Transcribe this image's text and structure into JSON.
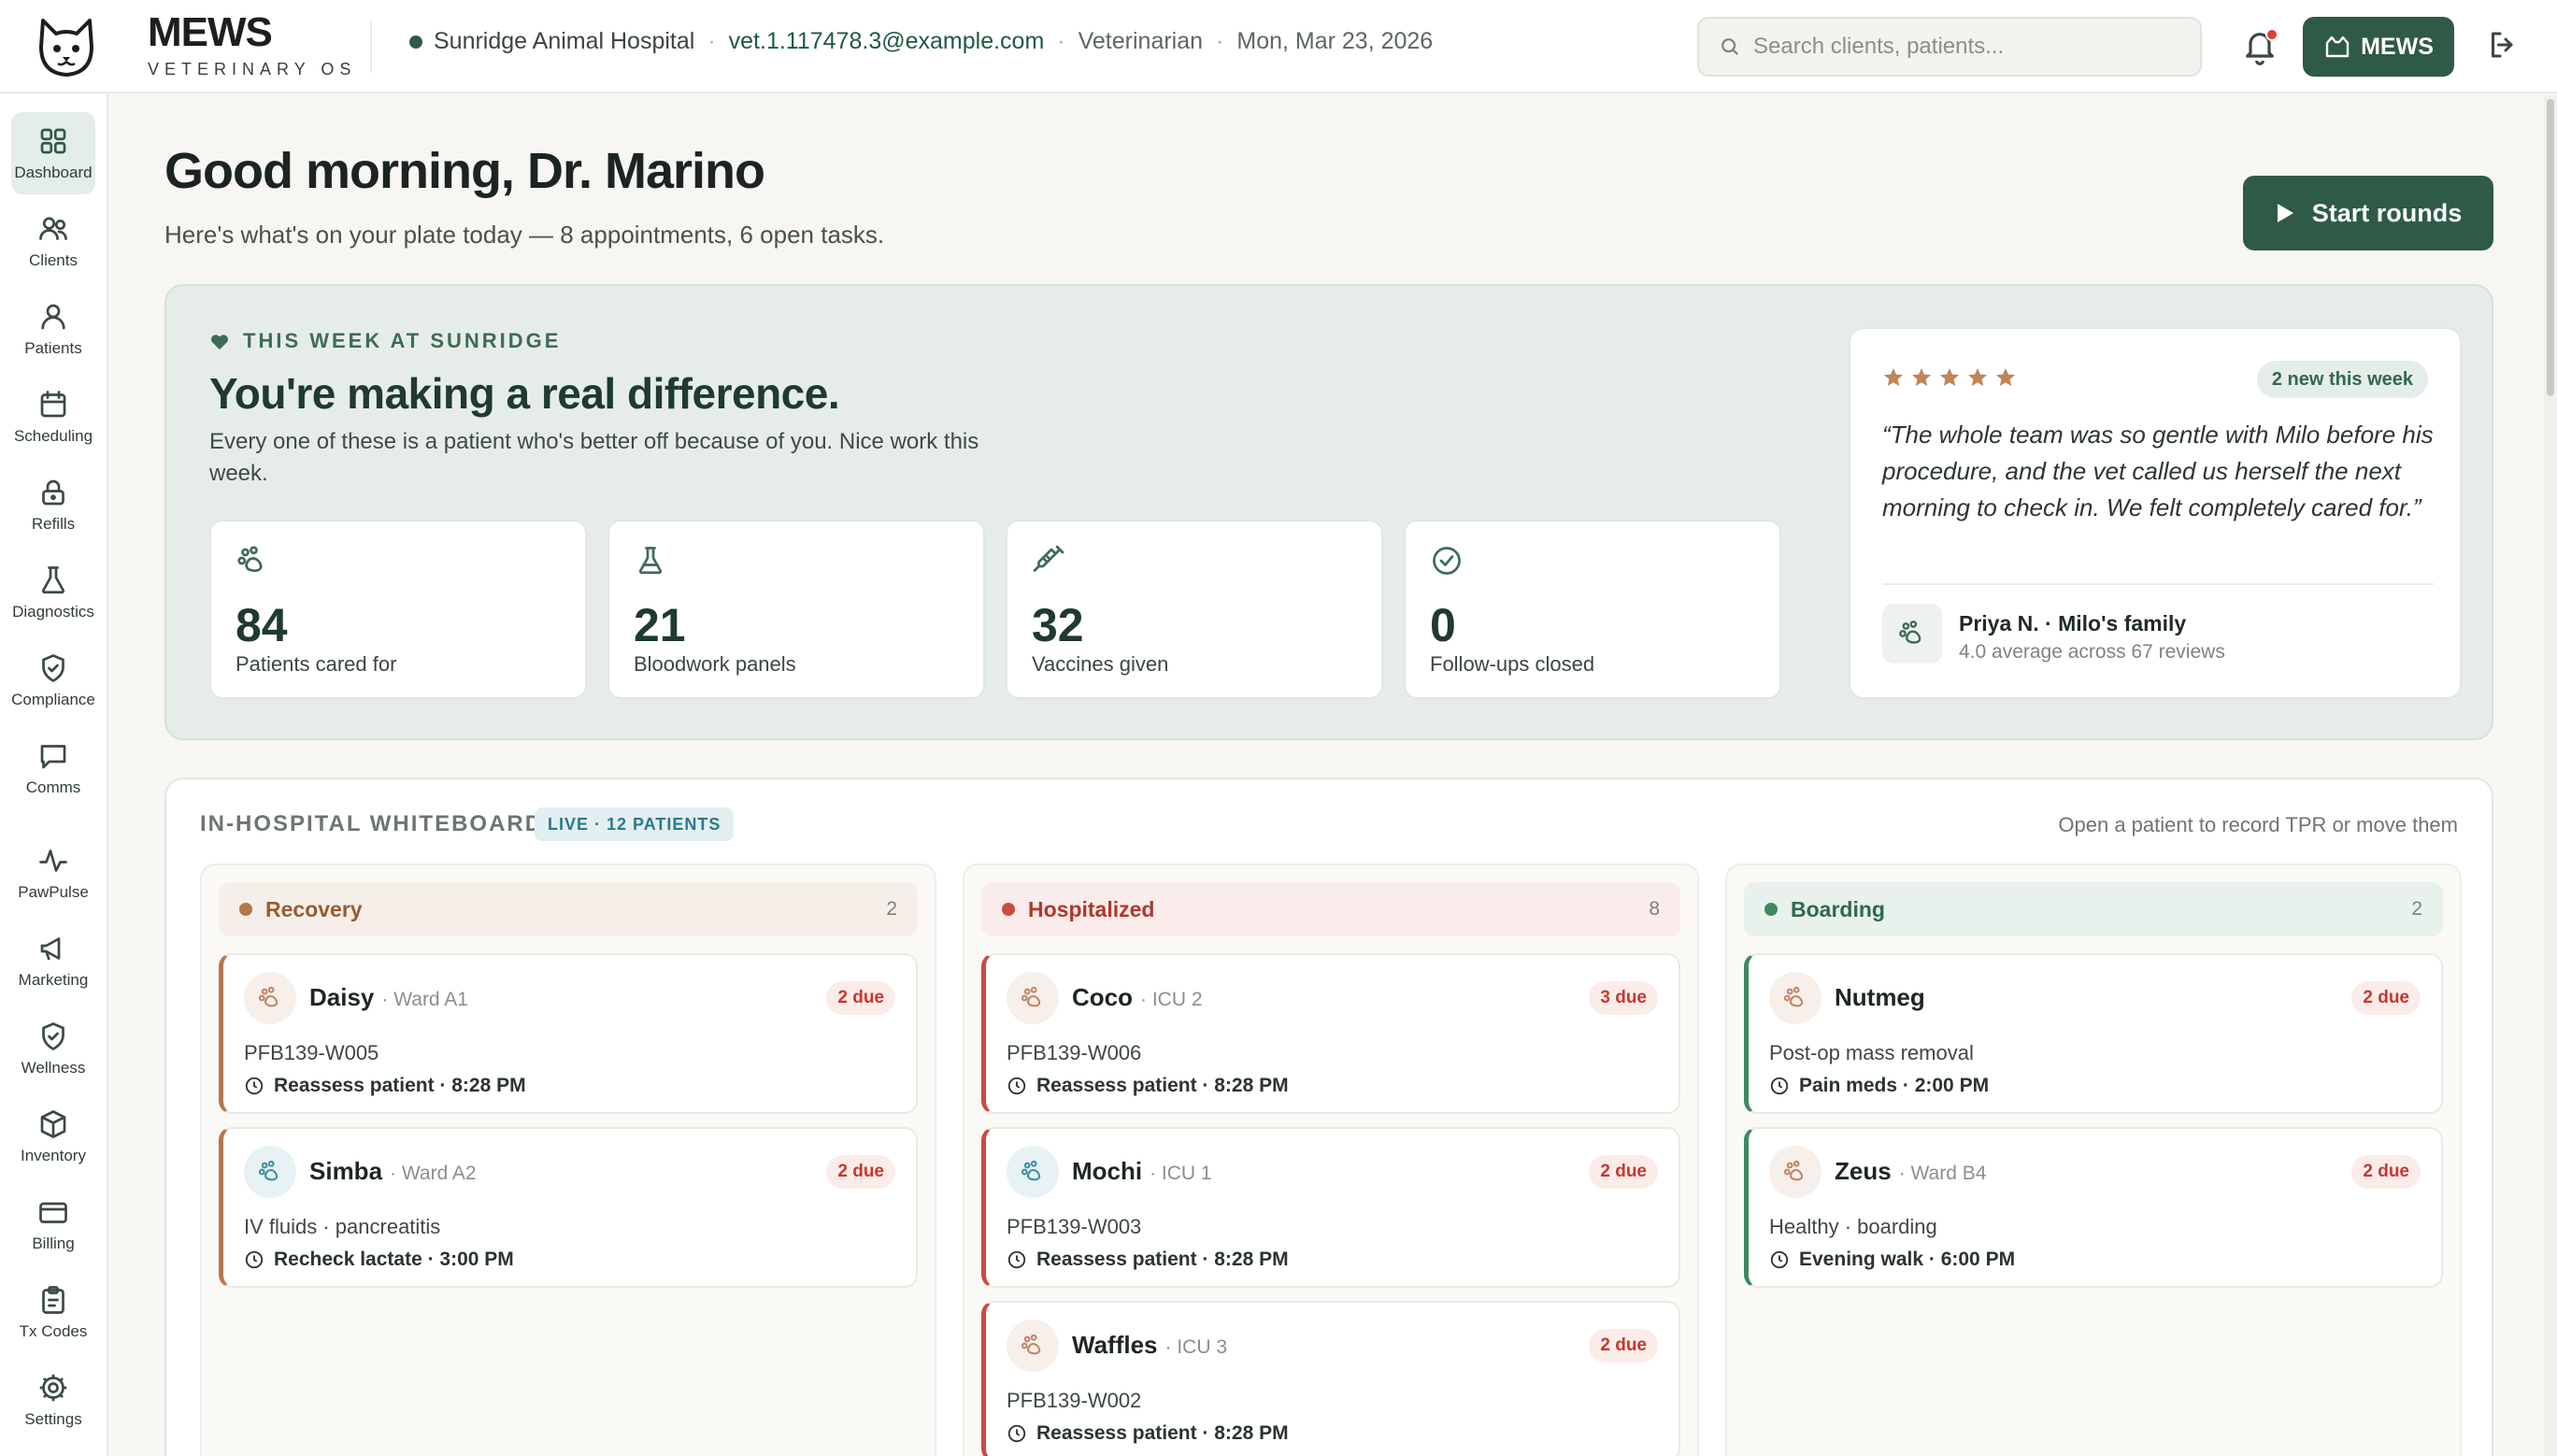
{
  "header": {
    "brand_name": "MEWS",
    "brand_sub": "VETERINARY OS",
    "clinic": "Sunridge Animal Hospital",
    "email": "vet.1.117478.3@example.com",
    "role": "Veterinarian",
    "date": "Mon, Mar 23, 2026",
    "search_placeholder": "Search clients, patients...",
    "mews_button": "MEWS",
    "sep": "·"
  },
  "sidebar": {
    "items": [
      {
        "label": "Dashboard",
        "icon": "grid-icon",
        "active": true
      },
      {
        "label": "Clients",
        "icon": "users-icon"
      },
      {
        "label": "Patients",
        "icon": "user-icon"
      },
      {
        "label": "Scheduling",
        "icon": "calendar-icon"
      },
      {
        "label": "Refills",
        "icon": "lock-icon"
      },
      {
        "label": "Diagnostics",
        "icon": "flask-icon"
      },
      {
        "label": "Compliance",
        "icon": "shield-check-icon"
      },
      {
        "label": "Comms",
        "icon": "chat-icon"
      },
      {
        "label": "PawPulse",
        "icon": "pulse-icon"
      },
      {
        "label": "Marketing",
        "icon": "megaphone-icon"
      },
      {
        "label": "Wellness",
        "icon": "shield-icon"
      },
      {
        "label": "Inventory",
        "icon": "box-icon"
      },
      {
        "label": "Billing",
        "icon": "card-icon"
      },
      {
        "label": "Tx Codes",
        "icon": "clipboard-icon"
      },
      {
        "label": "Settings",
        "icon": "gear-icon"
      }
    ]
  },
  "main": {
    "greeting": "Good morning, Dr. Marino",
    "subline": "Here's what's on your plate today — 8 appointments, 6 open tasks.",
    "start_rounds": "Start rounds"
  },
  "week": {
    "kicker": "THIS WEEK AT SUNRIDGE",
    "title": "You're making a real difference.",
    "desc": "Every one of these is a patient who's better off because of you. Nice work this week.",
    "stats": [
      {
        "value": "84",
        "label": "Patients cared for",
        "icon": "paw-icon"
      },
      {
        "value": "21",
        "label": "Bloodwork panels",
        "icon": "flask-icon"
      },
      {
        "value": "32",
        "label": "Vaccines given",
        "icon": "syringe-icon"
      },
      {
        "value": "0",
        "label": "Follow-ups closed",
        "icon": "check-circle-icon"
      }
    ],
    "review": {
      "stars": 5,
      "badge": "2 new this week",
      "quote": "“The whole team was so gentle with Milo before his procedure, and the vet called us herself the next morning to check in. We felt completely cared for.”",
      "reviewer": "Priya N. · Milo's family",
      "summary": "4.0 average across 67 reviews"
    }
  },
  "whiteboard": {
    "title": "IN-HOSPITAL WHITEBOARD",
    "live": "LIVE · 12 PATIENTS",
    "hint": "Open a patient to record TPR or move them",
    "columns": [
      {
        "name": "Recovery",
        "count": "2",
        "color": "#b5764a",
        "bg": "#f6efe9",
        "text": "#9a5a31",
        "patients": [
          {
            "name": "Daisy",
            "loc": "· Ward A1",
            "due": "2 due",
            "desc": "PFB139-W005",
            "task": "Reassess patient · 8:28 PM",
            "icon_color": "#c0876a"
          },
          {
            "name": "Simba",
            "loc": "· Ward A2",
            "due": "2 due",
            "desc": "IV fluids · pancreatitis",
            "task": "Recheck lactate · 3:00 PM",
            "icon_color": "#3f8fa3"
          }
        ]
      },
      {
        "name": "Hospitalized",
        "count": "8",
        "color": "#cc4a40",
        "bg": "#f9eceb",
        "text": "#b3362c",
        "patients": [
          {
            "name": "Coco",
            "loc": "· ICU 2",
            "due": "3 due",
            "desc": "PFB139-W006",
            "task": "Reassess patient · 8:28 PM",
            "icon_color": "#c0876a"
          },
          {
            "name": "Mochi",
            "loc": "· ICU 1",
            "due": "2 due",
            "desc": "PFB139-W003",
            "task": "Reassess patient · 8:28 PM",
            "icon_color": "#3f8fa3"
          },
          {
            "name": "Waffles",
            "loc": "· ICU 3",
            "due": "2 due",
            "desc": "PFB139-W002",
            "task": "Reassess patient · 8:28 PM",
            "icon_color": "#c0876a"
          }
        ]
      },
      {
        "name": "Boarding",
        "count": "2",
        "color": "#3e8a5e",
        "bg": "#e8f1eb",
        "text": "#2f6a4a",
        "patients": [
          {
            "name": "Nutmeg",
            "loc": "",
            "due": "2 due",
            "desc": "Post-op mass removal",
            "task": "Pain meds · 2:00 PM",
            "icon_color": "#c0876a"
          },
          {
            "name": "Zeus",
            "loc": "· Ward B4",
            "due": "2 due",
            "desc": "Healthy · boarding",
            "task": "Evening walk · 6:00 PM",
            "icon_color": "#c0876a"
          }
        ]
      }
    ]
  },
  "colors": {
    "accent": "#2f5a47",
    "panel_bg": "#e6ede9",
    "star": "#c08457",
    "alert": "#c8372d"
  }
}
